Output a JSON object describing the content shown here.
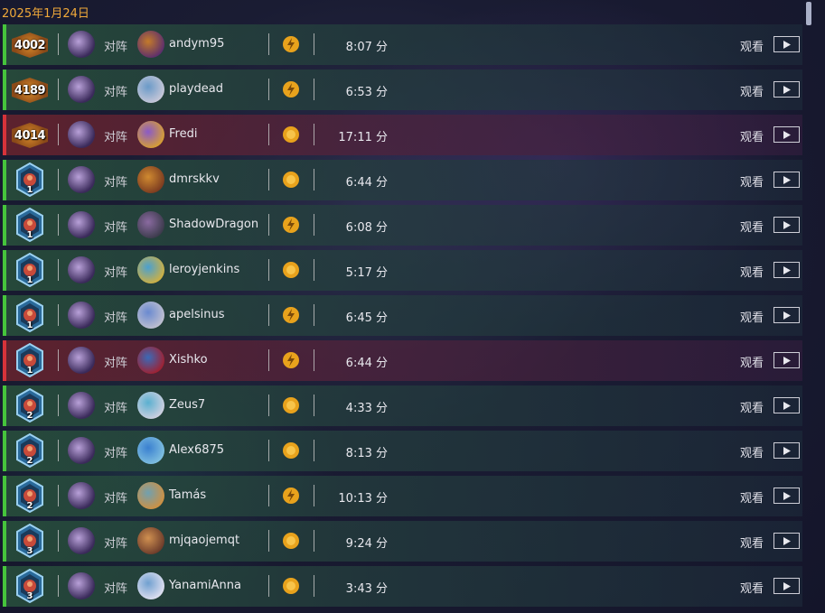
{
  "header": {
    "date": "2025年1月24日"
  },
  "labels": {
    "vs": "对阵",
    "watch": "观看",
    "minutes_unit": "分"
  },
  "colors": {
    "win": "#46c43c",
    "loss": "#d6333a",
    "date": "#f0a93a"
  },
  "matches": [
    {
      "result": "win",
      "rank_type": "legend",
      "rank": "4002",
      "opponent": "andym95",
      "coin": "coin-no-icon",
      "duration": "8:07 分"
    },
    {
      "result": "win",
      "rank_type": "legend",
      "rank": "4189",
      "opponent": "playdead",
      "coin": "coin-no-icon",
      "duration": "6:53 分"
    },
    {
      "result": "loss",
      "rank_type": "legend",
      "rank": "4014",
      "opponent": "Fredi",
      "coin": "coin-icon",
      "duration": "17:11 分"
    },
    {
      "result": "win",
      "rank_type": "diamond",
      "rank": "1",
      "opponent": "dmrskkv",
      "coin": "coin-icon",
      "duration": "6:44 分"
    },
    {
      "result": "win",
      "rank_type": "diamond",
      "rank": "1",
      "opponent": "ShadowDragon",
      "coin": "coin-no-icon",
      "duration": "6:08 分"
    },
    {
      "result": "win",
      "rank_type": "diamond",
      "rank": "1",
      "opponent": "leroyjenkins",
      "coin": "coin-icon",
      "duration": "5:17 分"
    },
    {
      "result": "win",
      "rank_type": "diamond",
      "rank": "1",
      "opponent": "apelsinus",
      "coin": "coin-no-icon",
      "duration": "6:45 分"
    },
    {
      "result": "loss",
      "rank_type": "diamond",
      "rank": "1",
      "opponent": "Xishko",
      "coin": "coin-no-icon",
      "duration": "6:44 分"
    },
    {
      "result": "win",
      "rank_type": "diamond",
      "rank": "2",
      "opponent": "Zeus7",
      "coin": "coin-icon",
      "duration": "4:33 分"
    },
    {
      "result": "win",
      "rank_type": "diamond",
      "rank": "2",
      "opponent": "Alex6875",
      "coin": "coin-icon",
      "duration": "8:13 分"
    },
    {
      "result": "win",
      "rank_type": "diamond",
      "rank": "2",
      "opponent": "Tamás",
      "coin": "coin-no-icon",
      "duration": "10:13 分"
    },
    {
      "result": "win",
      "rank_type": "diamond",
      "rank": "3",
      "opponent": "mjqaojemqt",
      "coin": "coin-icon",
      "duration": "9:24 分"
    },
    {
      "result": "win",
      "rank_type": "diamond",
      "rank": "3",
      "opponent": "YanamiAnna",
      "coin": "coin-icon",
      "duration": "3:43 分"
    }
  ]
}
